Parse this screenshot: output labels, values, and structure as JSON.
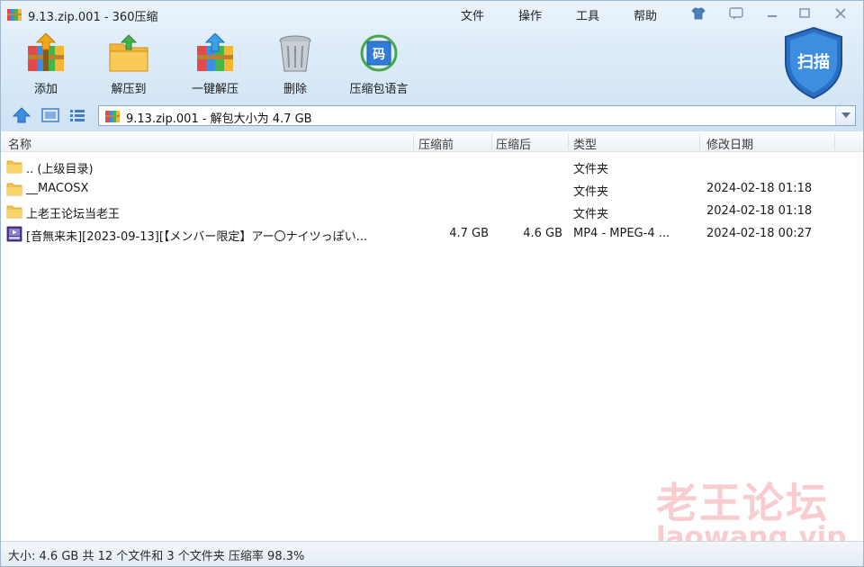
{
  "window": {
    "title": "9.13.zip.001 - 360压缩"
  },
  "menu": {
    "items": [
      "文件",
      "操作",
      "工具",
      "帮助"
    ]
  },
  "toolbar": {
    "buttons": [
      {
        "label": "添加",
        "icon": "add-archive-icon"
      },
      {
        "label": "解压到",
        "icon": "extract-to-icon"
      },
      {
        "label": "一键解压",
        "icon": "one-click-extract-icon"
      },
      {
        "label": "删除",
        "icon": "trash-icon"
      },
      {
        "label": "压缩包语言",
        "icon": "language-icon"
      }
    ],
    "scan_label": "扫描"
  },
  "address": {
    "text": "9.13.zip.001 - 解包大小为 4.7 GB"
  },
  "columns": [
    "名称",
    "压缩前",
    "压缩后",
    "类型",
    "修改日期"
  ],
  "files": [
    {
      "name": ".. (上级目录)",
      "before": "",
      "after": "",
      "type": "文件夹",
      "date": "",
      "icon": "folder-icon"
    },
    {
      "name": "__MACOSX",
      "before": "",
      "after": "",
      "type": "文件夹",
      "date": "2024-02-18 01:18",
      "icon": "folder-icon"
    },
    {
      "name": "上老王论坛当老王",
      "before": "",
      "after": "",
      "type": "文件夹",
      "date": "2024-02-18 01:18",
      "icon": "folder-icon"
    },
    {
      "name": "[音無来未][2023-09-13][【メンバー限定】アー〇ナイツっぽい...",
      "before": "4.7 GB",
      "after": "4.6 GB",
      "type": "MP4 - MPEG-4 ...",
      "date": "2024-02-18 00:27",
      "icon": "video-file-icon"
    }
  ],
  "status": {
    "text": "大小: 4.6 GB 共 12 个文件和 3 个文件夹 压缩率 98.3%"
  },
  "watermark": {
    "line1": "老王论坛",
    "line2": "laowang.vip"
  }
}
